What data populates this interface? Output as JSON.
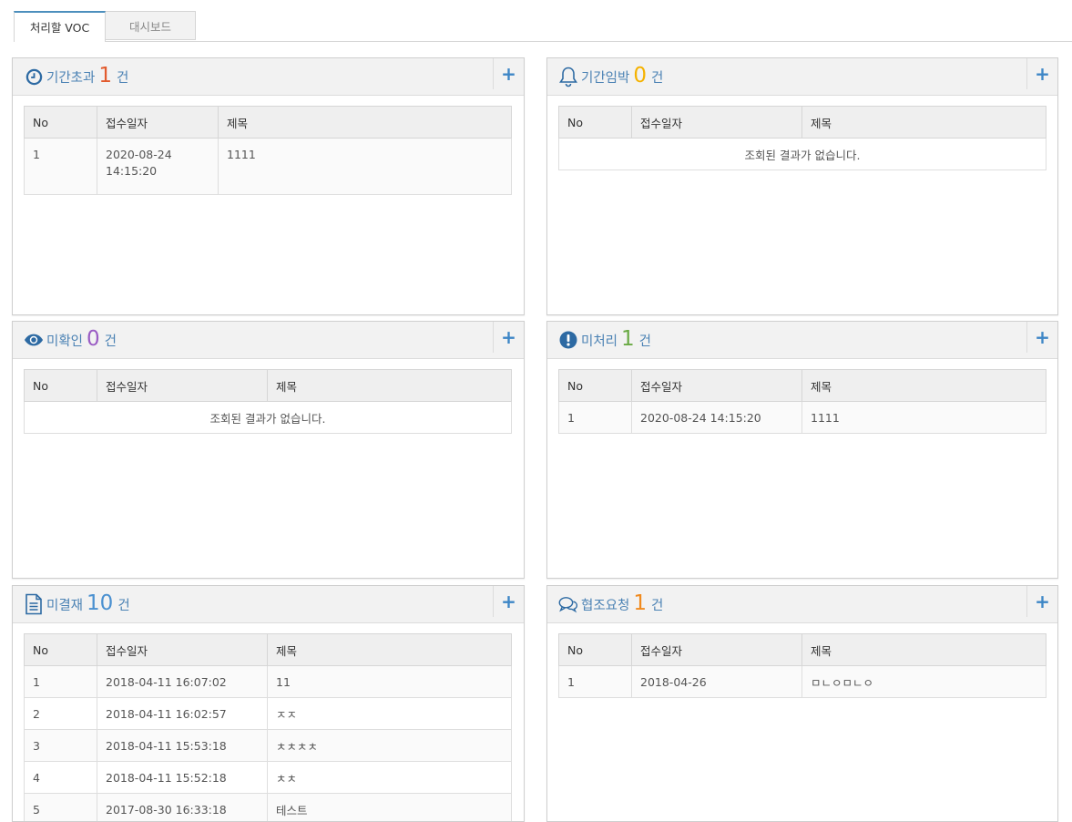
{
  "tabs": [
    {
      "label": "처리할 VOC"
    },
    {
      "label": "대시보드"
    }
  ],
  "colors": {
    "accent": "#4b82b4",
    "plus": "#3d86c6",
    "red": "#e25b2e",
    "amber": "#f5b200",
    "purple": "#9a5cc4",
    "green": "#6aaa44",
    "blue": "#4a90d0",
    "orange": "#f08a1e"
  },
  "panels": [
    {
      "id": "overdue",
      "icon": "clock-icon",
      "title": "기간초과",
      "count": "1",
      "unit": "건",
      "count_color": "#e25b2e",
      "headers": [
        "No",
        "접수일자",
        "제목"
      ],
      "rows": [
        {
          "no": "1",
          "date": "2020-08-24 14:15:20",
          "title": "1111"
        }
      ],
      "empty": ""
    },
    {
      "id": "imminent",
      "icon": "bell-icon",
      "title": "기간임박",
      "count": "0",
      "unit": "건",
      "count_color": "#f5b200",
      "headers": [
        "No",
        "접수일자",
        "제목"
      ],
      "rows": [],
      "empty": "조회된 결과가 없습니다."
    },
    {
      "id": "unread",
      "icon": "eye-icon",
      "title": "미확인",
      "count": "0",
      "unit": "건",
      "count_color": "#9a5cc4",
      "headers": [
        "No",
        "접수일자",
        "제목"
      ],
      "rows": [],
      "empty": "조회된 결과가 없습니다."
    },
    {
      "id": "unprocessed",
      "icon": "exclamation-icon",
      "title": "미처리",
      "count": "1",
      "unit": "건",
      "count_color": "#6aaa44",
      "headers": [
        "No",
        "접수일자",
        "제목"
      ],
      "rows": [
        {
          "no": "1",
          "date": "2020-08-24 14:15:20",
          "title": "1111"
        }
      ],
      "empty": ""
    },
    {
      "id": "unapproved",
      "icon": "document-icon",
      "title": "미결재",
      "count": "10",
      "unit": "건",
      "count_color": "#4a90d0",
      "headers": [
        "No",
        "접수일자",
        "제목"
      ],
      "rows": [
        {
          "no": "1",
          "date": "2018-04-11 16:07:02",
          "title": "11"
        },
        {
          "no": "2",
          "date": "2018-04-11 16:02:57",
          "title": "ㅈㅈ"
        },
        {
          "no": "3",
          "date": "2018-04-11 15:53:18",
          "title": "ㅊㅊㅊㅊ"
        },
        {
          "no": "4",
          "date": "2018-04-11 15:52:18",
          "title": "ㅊㅊ"
        },
        {
          "no": "5",
          "date": "2017-08-30 16:33:18",
          "title": "테스트"
        }
      ],
      "empty": ""
    },
    {
      "id": "cooperation",
      "icon": "chat-icon",
      "title": "협조요청",
      "count": "1",
      "unit": "건",
      "count_color": "#f08a1e",
      "headers": [
        "No",
        "접수일자",
        "제목"
      ],
      "rows": [
        {
          "no": "1",
          "date": "2018-04-26",
          "title": "ㅁㄴㅇㅁㄴㅇ"
        }
      ],
      "empty": ""
    }
  ],
  "plus_label": "+"
}
